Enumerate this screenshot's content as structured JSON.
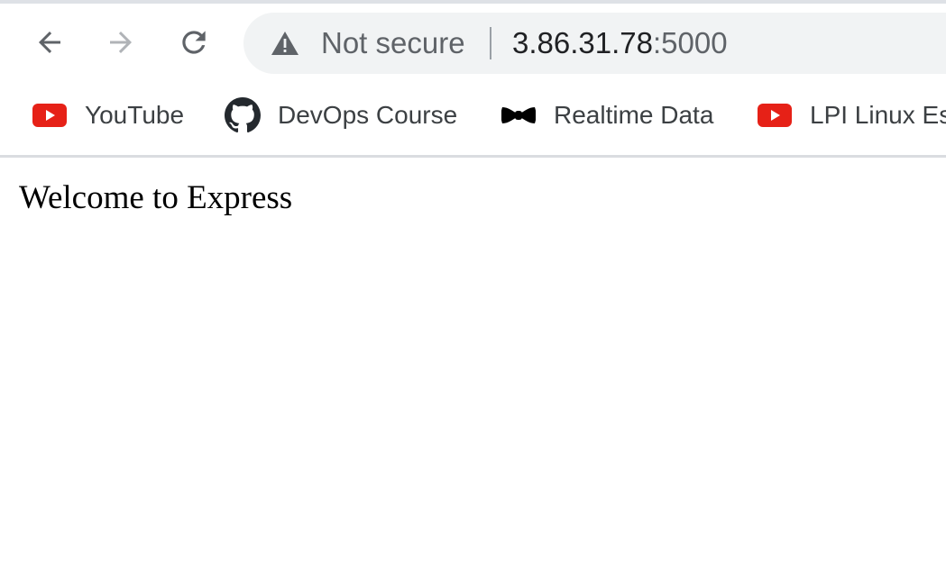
{
  "colors": {
    "toolbar_bg": "#ffffff",
    "omnibox_bg": "#f1f3f4",
    "icon_gray": "#5f6368",
    "icon_disabled": "#b0b3b7",
    "youtube_red": "#e62117"
  },
  "nav": {
    "back_icon": "back-arrow-icon",
    "forward_icon": "forward-arrow-icon",
    "reload_icon": "reload-icon"
  },
  "omnibox": {
    "security_icon": "warning-triangle-icon",
    "security_label": "Not secure",
    "host": "3.86.31.78",
    "port": ":5000"
  },
  "bookmarks": [
    {
      "label": "YouTube",
      "icon": "youtube-icon"
    },
    {
      "label": "DevOps Course",
      "icon": "github-icon"
    },
    {
      "label": "Realtime Data",
      "icon": "bowtie-icon"
    },
    {
      "label": "LPI Linux Es",
      "icon": "youtube-icon"
    }
  ],
  "page": {
    "heading": "Welcome to Express"
  }
}
